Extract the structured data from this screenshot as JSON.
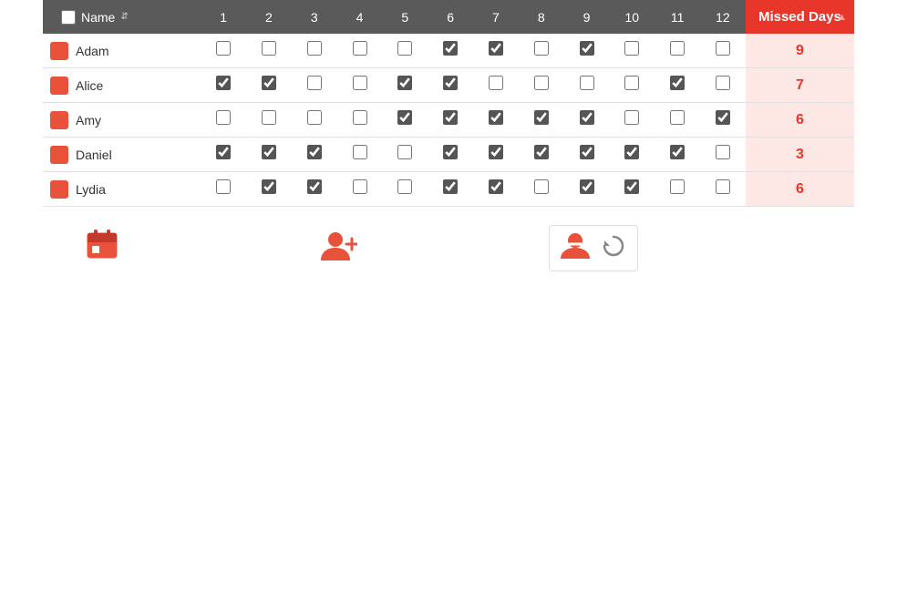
{
  "header": {
    "checkbox_label": "",
    "name_label": "Name",
    "sort_icon": "↕",
    "columns": [
      "1",
      "2",
      "3",
      "4",
      "5",
      "6",
      "7",
      "8",
      "9",
      "10",
      "11",
      "12"
    ],
    "missed_days_label": "Missed Days",
    "missed_sort": "▲"
  },
  "rows": [
    {
      "name": "Adam",
      "color": "#e8523a",
      "checks": [
        false,
        false,
        false,
        false,
        false,
        true,
        true,
        false,
        true,
        false,
        false,
        false
      ],
      "missed": "9"
    },
    {
      "name": "Alice",
      "color": "#e8523a",
      "checks": [
        true,
        true,
        false,
        false,
        true,
        true,
        false,
        false,
        false,
        false,
        true,
        false
      ],
      "missed": "7"
    },
    {
      "name": "Amy",
      "color": "#e8523a",
      "checks": [
        false,
        false,
        false,
        false,
        true,
        true,
        true,
        true,
        true,
        false,
        false,
        true
      ],
      "missed": "6"
    },
    {
      "name": "Daniel",
      "color": "#e8523a",
      "checks": [
        true,
        true,
        true,
        false,
        false,
        true,
        true,
        true,
        true,
        true,
        true,
        false
      ],
      "missed": "3"
    },
    {
      "name": "Lydia",
      "color": "#e8523a",
      "checks": [
        false,
        true,
        true,
        false,
        false,
        true,
        true,
        false,
        true,
        true,
        false,
        false
      ],
      "missed": "6"
    }
  ],
  "toolbar": {
    "calendar_label": "calendar",
    "add_user_label": "add user",
    "remove_user_label": "remove user",
    "refresh_label": "refresh"
  }
}
